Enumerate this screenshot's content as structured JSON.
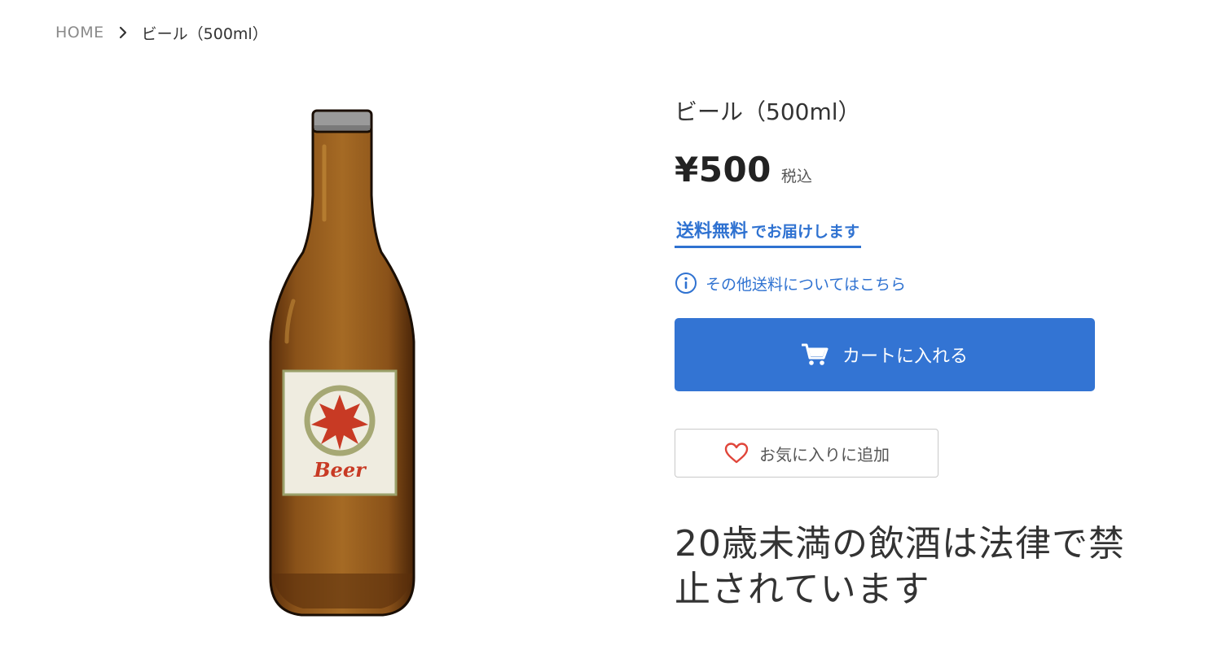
{
  "breadcrumb": {
    "home": "HOME",
    "current": "ビール（500ml）"
  },
  "product": {
    "image_name": "beer-bottle",
    "label_text": "Beer",
    "title": "ビール（500ml）",
    "price": "¥500",
    "tax_note": "税込",
    "shipping_free": "送料無料",
    "shipping_rest": "でお届けします",
    "other_shipping": "その他送料についてはこちら",
    "cart_button": "カートに入れる",
    "favorite_button": "お気に入りに追加",
    "age_warning": "20歳未満の飲酒は法律で禁止されています"
  },
  "icons": {
    "breadcrumb_separator": "chevron-right-icon",
    "info": "info-icon",
    "cart": "cart-icon",
    "favorite": "heart-icon"
  },
  "colors": {
    "accent": "#3374d3",
    "link": "#2f72d1",
    "heart": "#e0453a"
  }
}
